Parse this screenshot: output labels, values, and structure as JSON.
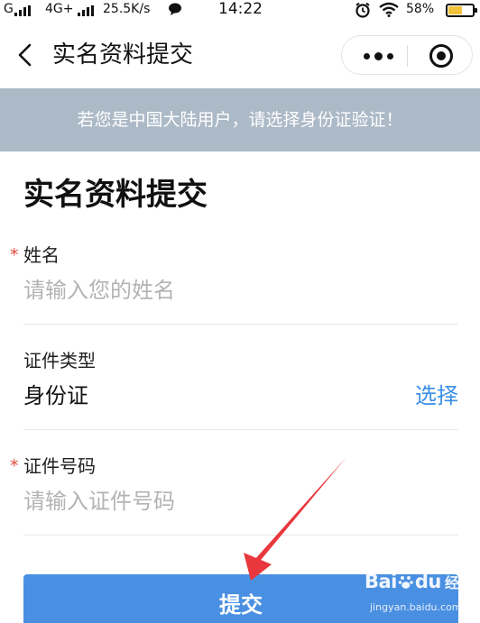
{
  "status_bar": {
    "carrier1": "G",
    "network": "4G+",
    "speed": "25.5K/s",
    "time": "14:22",
    "battery_percent": "58%",
    "battery_level": 0.58,
    "icons": [
      "signal-icon",
      "chat-bubble-icon",
      "alarm-icon",
      "wifi-icon",
      "battery-icon"
    ]
  },
  "nav": {
    "title": "实名资料提交",
    "icons": [
      "back-arrow-icon",
      "more-dots-icon",
      "target-icon"
    ]
  },
  "notice": {
    "text": "若您是中国大陆用户，请选择身份证验证！"
  },
  "form": {
    "title": "实名资料提交",
    "name": {
      "label": "姓名",
      "required_mark": "*",
      "placeholder": "请输入您的姓名"
    },
    "id_type": {
      "label": "证件类型",
      "value": "身份证",
      "action": "选择"
    },
    "id_number": {
      "label": "证件号码",
      "required_mark": "*",
      "placeholder": "请输入证件号码"
    },
    "submit_label": "提交"
  },
  "colors": {
    "notice_bg": "#acb9c7",
    "accent_link": "#3a8ee6",
    "submit_bg": "#4a90e2",
    "required": "#e04b3b",
    "annotation_arrow": "#e8383d"
  },
  "watermark": {
    "brand": "Bai",
    "brand_suffix": "du",
    "product": "经验",
    "url": "jingyan.baidu.com"
  }
}
